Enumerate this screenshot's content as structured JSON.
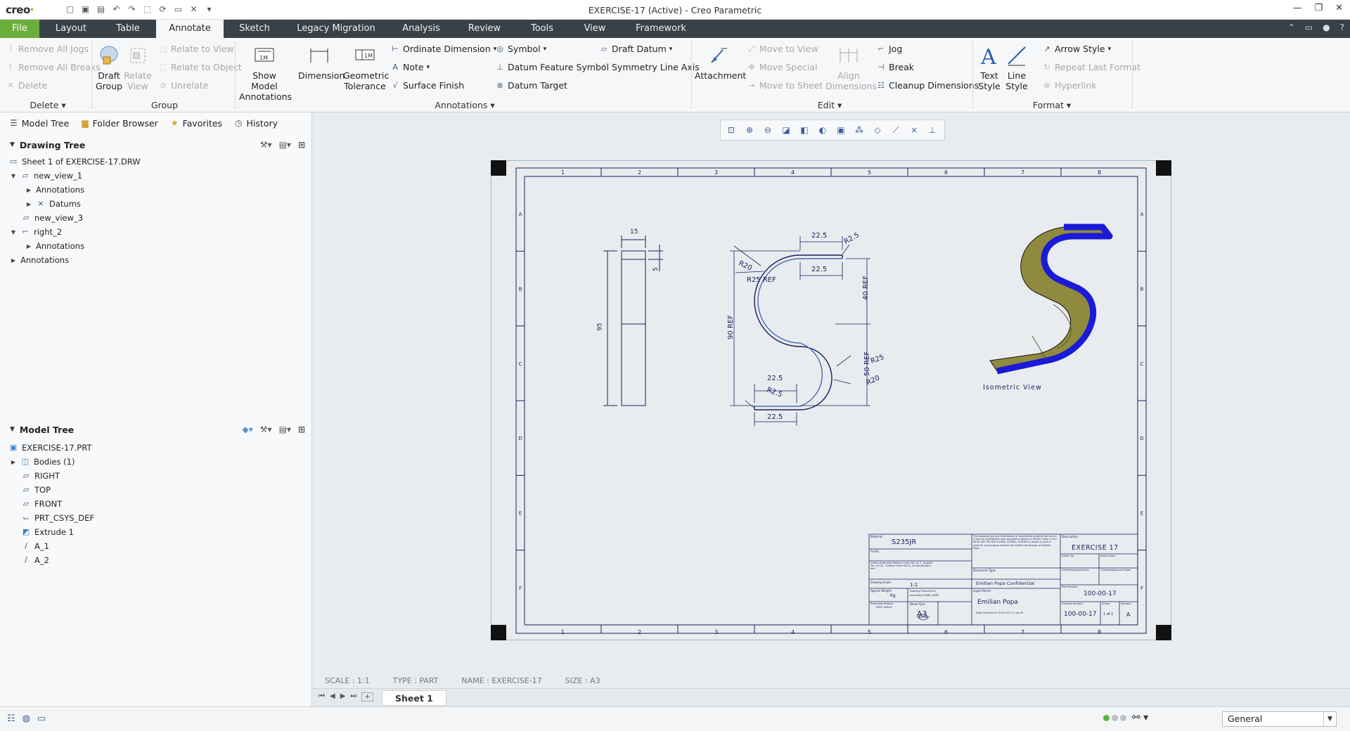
{
  "window": {
    "logo": "creo",
    "title": "EXERCISE-17 (Active) - Creo Parametric"
  },
  "menu": {
    "tabs": [
      "File",
      "Layout",
      "Table",
      "Annotate",
      "Sketch",
      "Legacy Migration",
      "Analysis",
      "Review",
      "Tools",
      "View",
      "Framework"
    ],
    "active": "Annotate"
  },
  "ribbon": {
    "delete_group": {
      "remove_all_jogs": "Remove All Jogs",
      "remove_all_breaks": "Remove All Breaks",
      "delete": "Delete",
      "label": "Delete"
    },
    "group_group": {
      "draft_group": "Draft\nGroup",
      "relate_view": "Relate\nView",
      "relate_to_view": "Relate to View",
      "relate_to_object": "Relate to Object",
      "unrelate": "Unrelate",
      "label": "Group"
    },
    "annotations_group": {
      "show_model_annotations": "Show Model\nAnnotations",
      "dimension": "Dimension",
      "geometric_tolerance": "Geometric\nTolerance",
      "ordinate_dimension": "Ordinate Dimension",
      "note": "Note",
      "surface_finish": "Surface Finish",
      "symbol": "Symbol",
      "datum_feature_symbol": "Datum Feature Symbol",
      "datum_target": "Datum Target",
      "draft_datum": "Draft Datum",
      "symmetry_line_axis": "Symmetry Line Axis",
      "label": "Annotations"
    },
    "edit_group": {
      "attachment": "Attachment",
      "move_to_view": "Move to View",
      "move_special": "Move Special",
      "move_to_sheet": "Move to Sheet",
      "align_dimensions": "Align\nDimensions",
      "jog": "Jog",
      "break": "Break",
      "cleanup_dimensions": "Cleanup Dimensions",
      "label": "Edit"
    },
    "format_group": {
      "text_style": "Text\nStyle",
      "line_style": "Line\nStyle",
      "arrow_style": "Arrow Style",
      "repeat_last_format": "Repeat Last Format",
      "hyperlink": "Hyperlink",
      "label": "Format"
    }
  },
  "left_panel": {
    "tabs": [
      "Model Tree",
      "Folder Browser",
      "Favorites",
      "History"
    ],
    "drawing_tree": {
      "title": "Drawing Tree",
      "items": [
        "Sheet 1 of EXERCISE-17.DRW",
        "new_view_1",
        "Annotations",
        "Datums",
        "new_view_3",
        "right_2",
        "Annotations",
        "Annotations"
      ]
    },
    "model_tree": {
      "title": "Model Tree",
      "items": [
        "EXERCISE-17.PRT",
        "Bodies (1)",
        "RIGHT",
        "TOP",
        "FRONT",
        "PRT_CSYS_DEF",
        "Extrude 1",
        "A_1",
        "A_2"
      ]
    }
  },
  "drawing": {
    "col_labels": [
      "1",
      "2",
      "3",
      "4",
      "5",
      "6",
      "7",
      "8"
    ],
    "row_labels": [
      "A",
      "B",
      "C",
      "D",
      "E",
      "F"
    ],
    "side_view_dims": [
      "15",
      "5",
      "95"
    ],
    "front_view_dims": [
      "22.5",
      "R2.5",
      "22.5",
      "R20",
      "R25 REF",
      "40 REF",
      "90 REF",
      "R25",
      "R20",
      "50 REF",
      "22.5",
      "R2.5",
      "22.5"
    ],
    "isometric_label": "Isometric View",
    "title_block": {
      "material_label": "Material:",
      "material": "S235JR",
      "finish_label": "Finish:",
      "tolerance_note": "Unless Otherwise Stated: Linear Tol: ±0.1, Angular Tol: ±0°15', Surface Finish Ra3.2, All Dimensions: mm",
      "drawing_scale_label": "Drawing Scale:",
      "drawing_scale": "1:1",
      "approx_weight_label": "Approx Weight:",
      "approx_weight": "Kg",
      "drawing_produced_label": "Drawing Produced to",
      "drawing_produced": "Accordance With: ASME",
      "projection_label": "Projection Method:",
      "projection": "FIRST ANGLE",
      "sheet_size_label": "Sheet Size:",
      "sheet_size": "A3",
      "confidential_text": "This drawing and any information or descriptive material set out on it are the confidential and copyright property of Emilian Popa & and MUST NOT BE DISCLOSED, COPIED, LOANED in whole or part or used for any purpose without the written permission of Emilian Popa",
      "document_type_label": "Document Type:",
      "confidential": "Emilian Popa Confidential",
      "legal_owner_label": "Legal Owner:",
      "legal_owner": "Emilian Popa",
      "draft_checked": "Draft Checked at 12.01.012 in 1 op 16",
      "description_label": "Description:",
      "description": "EXERCISE 17",
      "drawn_by_label": "Drawn By:",
      "drawn_date_label": "Drawn Date:",
      "checked_label": "Checked/Approved by:",
      "checked_date_label": "Checked/Approved Date:",
      "part_number_label": "Part Number:",
      "part_number": "100-00-17",
      "drawing_number_label": "Drawing Number:",
      "drawing_number": "100-00-17",
      "sheet_label": "Sheet:",
      "sheet": "1 of 1",
      "revision_label": "Revision:",
      "revision": "A"
    }
  },
  "status": {
    "scale": "SCALE : 1:1",
    "type": "TYPE : PART",
    "name": "NAME : EXERCISE-17",
    "size": "SIZE : A3",
    "sheet_tab": "Sheet 1",
    "filter": "General"
  },
  "colors": {
    "menubar_bg": "#394148",
    "file_tab": "#6aae3c",
    "drawing_line": "#1a1f5c",
    "extrude_blue": "#1a1ad8",
    "extrude_olive": "#8f8a3e"
  }
}
